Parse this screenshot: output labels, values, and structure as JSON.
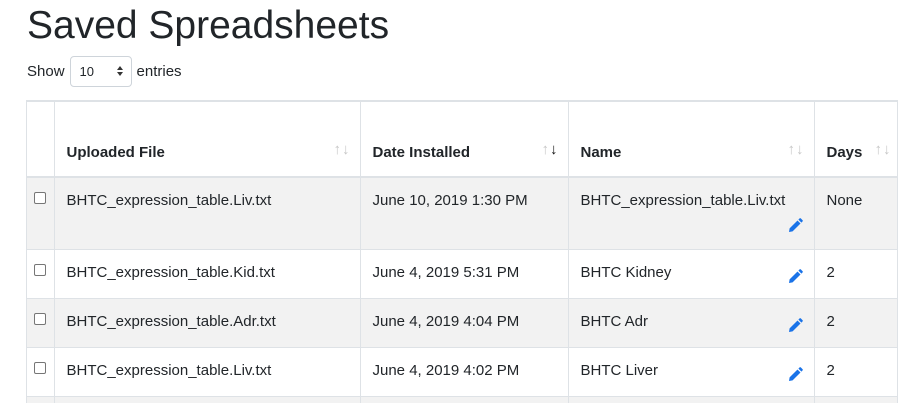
{
  "page": {
    "title": "Saved Spreadsheets"
  },
  "length_control": {
    "prefix": "Show",
    "selected": "10",
    "suffix": "entries"
  },
  "table": {
    "columns": [
      {
        "label": "",
        "key": "select"
      },
      {
        "label": "Uploaded File",
        "sort": "none"
      },
      {
        "label": "Date Installed",
        "sort": "desc"
      },
      {
        "label": "Name",
        "sort": "none"
      },
      {
        "label": "Days",
        "sort": "none"
      }
    ],
    "rows": [
      {
        "file": "BHTC_expression_table.Liv.txt",
        "date": "June 10, 2019 1:30 PM",
        "name": "BHTC_expression_table.Liv.txt",
        "days": "None"
      },
      {
        "file": "BHTC_expression_table.Kid.txt",
        "date": "June 4, 2019 5:31 PM",
        "name": "BHTC Kidney",
        "days": "2"
      },
      {
        "file": "BHTC_expression_table.Adr.txt",
        "date": "June 4, 2019 4:04 PM",
        "name": "BHTC Adr",
        "days": "2"
      },
      {
        "file": "BHTC_expression_table.Liv.txt",
        "date": "June 4, 2019 4:02 PM",
        "name": "BHTC Liver",
        "days": "2"
      }
    ]
  },
  "icons": {
    "edit": "pencil-icon",
    "sort": "sort-arrows-icon"
  },
  "colors": {
    "accent": "#1a73e8",
    "stripe": "#f2f2f2",
    "border": "#dee2e6"
  }
}
